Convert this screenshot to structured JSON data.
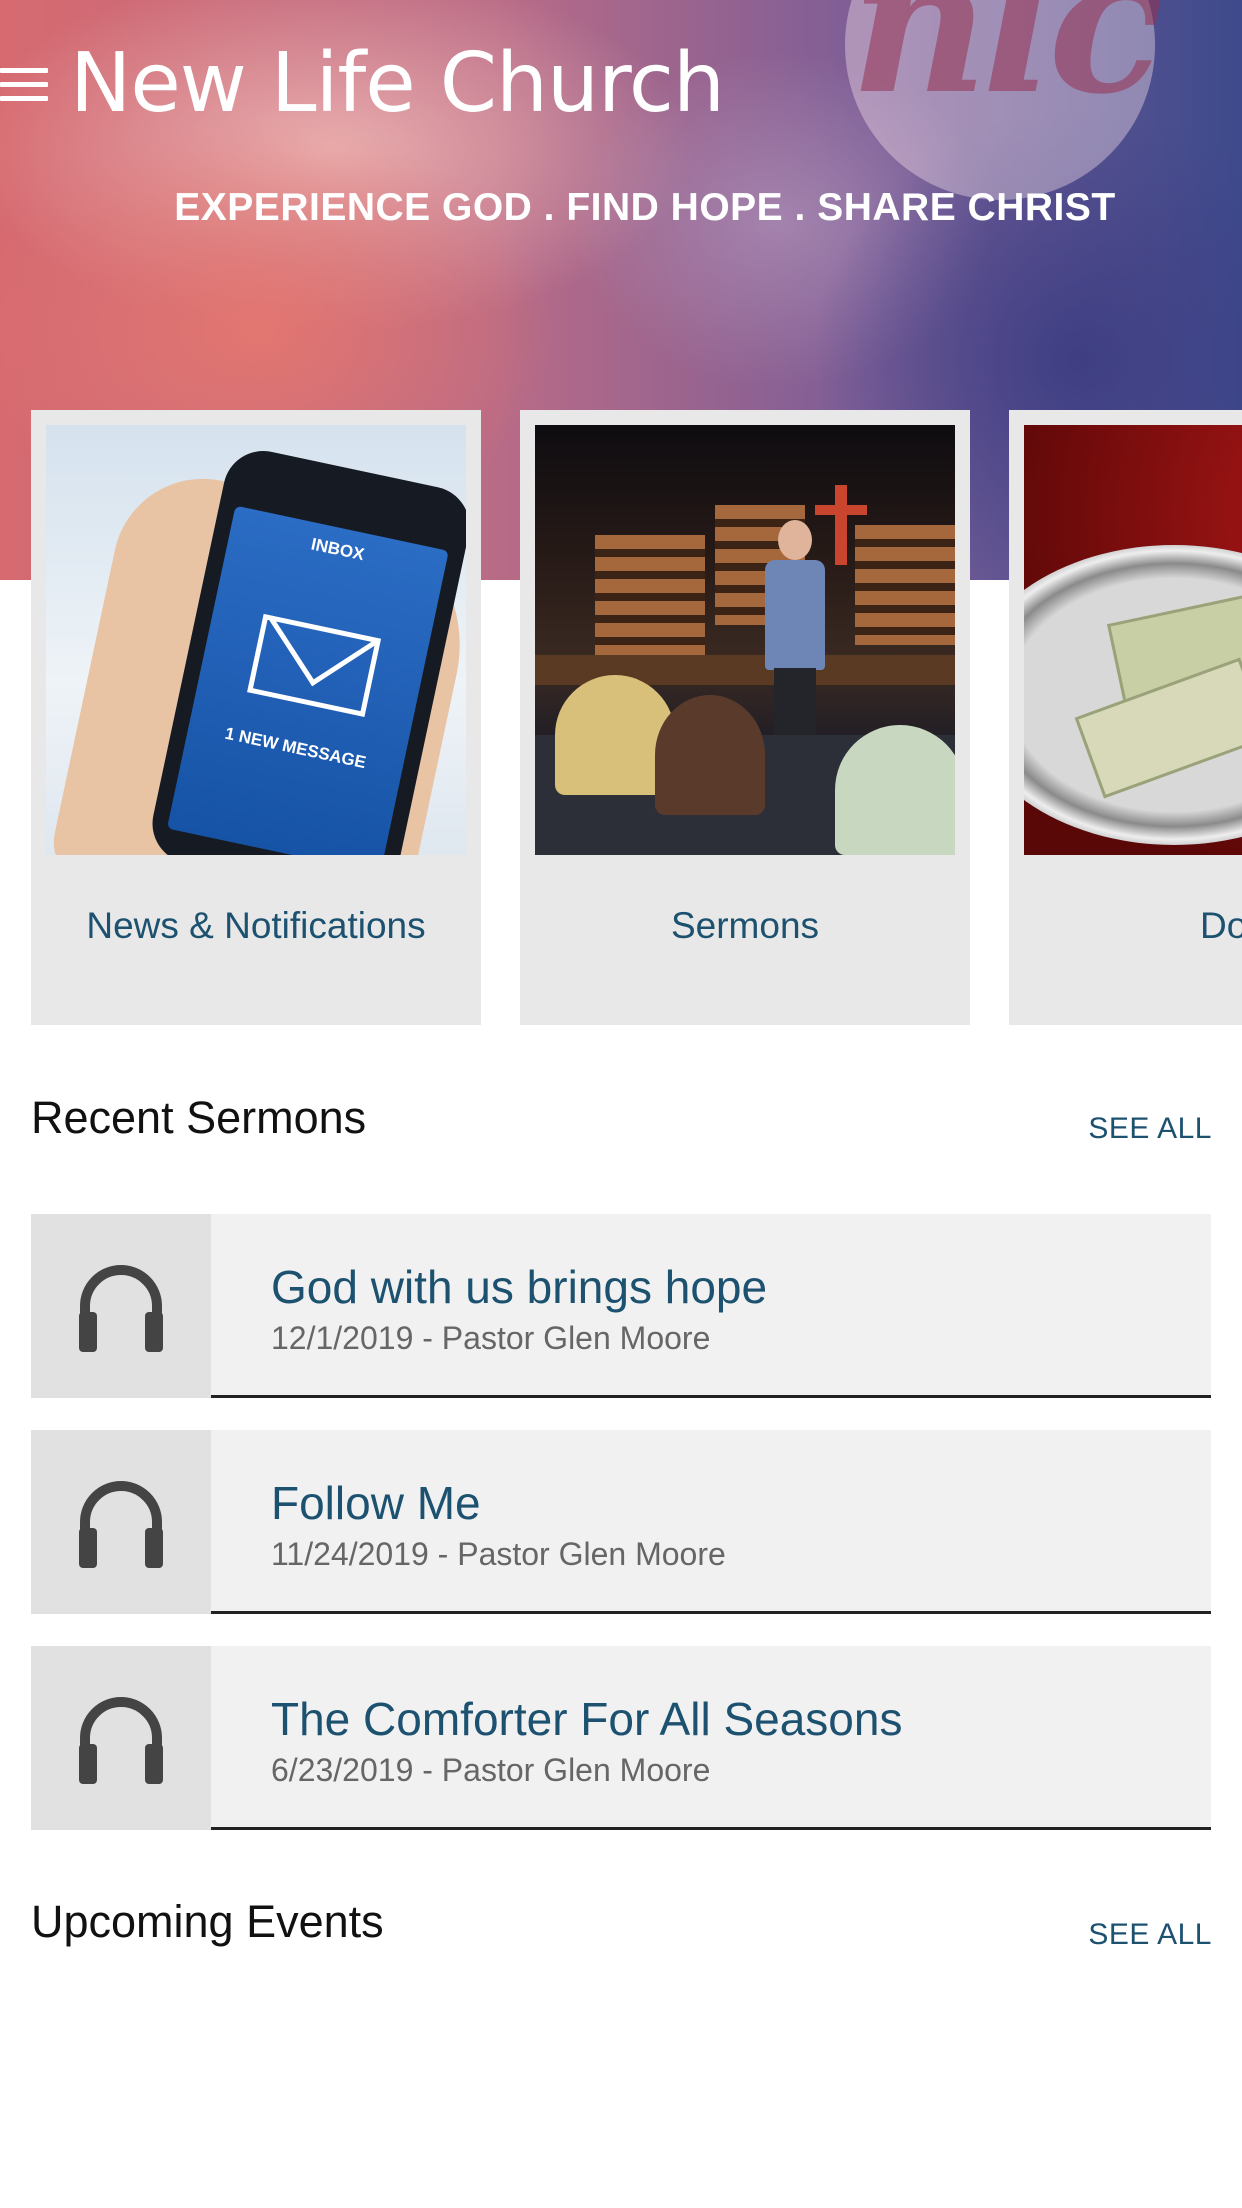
{
  "header": {
    "title": "New Life Church",
    "tagline": "EXPERIENCE GOD . FIND HOPE . SHARE CHRIST",
    "logo_text": "nlc",
    "menu_icon": "hamburger-menu-icon"
  },
  "cards": [
    {
      "label": "News & Notifications",
      "image": "phone-inbox-new-message",
      "screen_title": "INBOX",
      "screen_message": "1 NEW MESSAGE"
    },
    {
      "label": "Sermons",
      "image": "pastor-preaching-stage"
    },
    {
      "label": "Don",
      "image": "offering-plate-money"
    }
  ],
  "recent_sermons": {
    "title": "Recent Sermons",
    "see_all": "SEE ALL",
    "items": [
      {
        "title": "God with us brings hope",
        "subtitle": "12/1/2019 - Pastor Glen Moore",
        "icon": "headphones-icon"
      },
      {
        "title": "Follow Me",
        "subtitle": "11/24/2019 - Pastor Glen Moore",
        "icon": "headphones-icon"
      },
      {
        "title": "The Comforter For All Seasons",
        "subtitle": "6/23/2019 - Pastor Glen Moore",
        "icon": "headphones-icon"
      }
    ]
  },
  "upcoming_events": {
    "title": "Upcoming Events",
    "see_all": "SEE ALL"
  },
  "colors": {
    "accent_text": "#1d5170",
    "card_bg": "#e8e8e8",
    "list_bg": "#f1f1f1",
    "icon_bg": "#e1e1e1"
  }
}
